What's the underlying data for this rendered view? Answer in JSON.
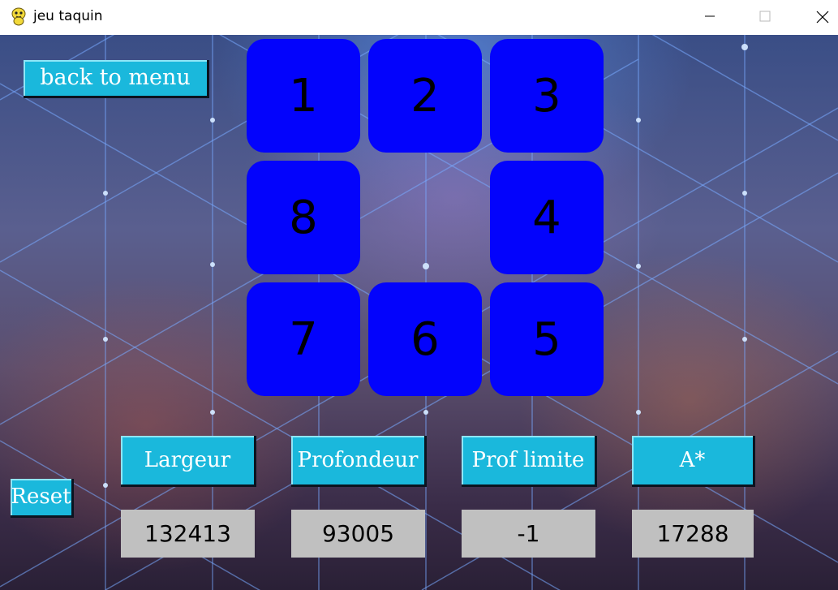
{
  "window": {
    "title": "jeu taquin",
    "icon": "pygame-snake-icon"
  },
  "menu": {
    "back_label": "back to menu"
  },
  "board": {
    "tiles": [
      "1",
      "2",
      "3",
      "8",
      "",
      "4",
      "7",
      "6",
      "5"
    ],
    "tile_color": "#0303fc"
  },
  "algorithms": {
    "buttons": [
      "Largeur",
      "Profondeur",
      "Prof limite",
      "A*"
    ],
    "results": [
      "132413",
      "93005",
      "-1",
      "17288"
    ]
  },
  "reset_label": "Reset",
  "colors": {
    "button": "#1ab8dc",
    "result_box": "#c0c0c0"
  }
}
